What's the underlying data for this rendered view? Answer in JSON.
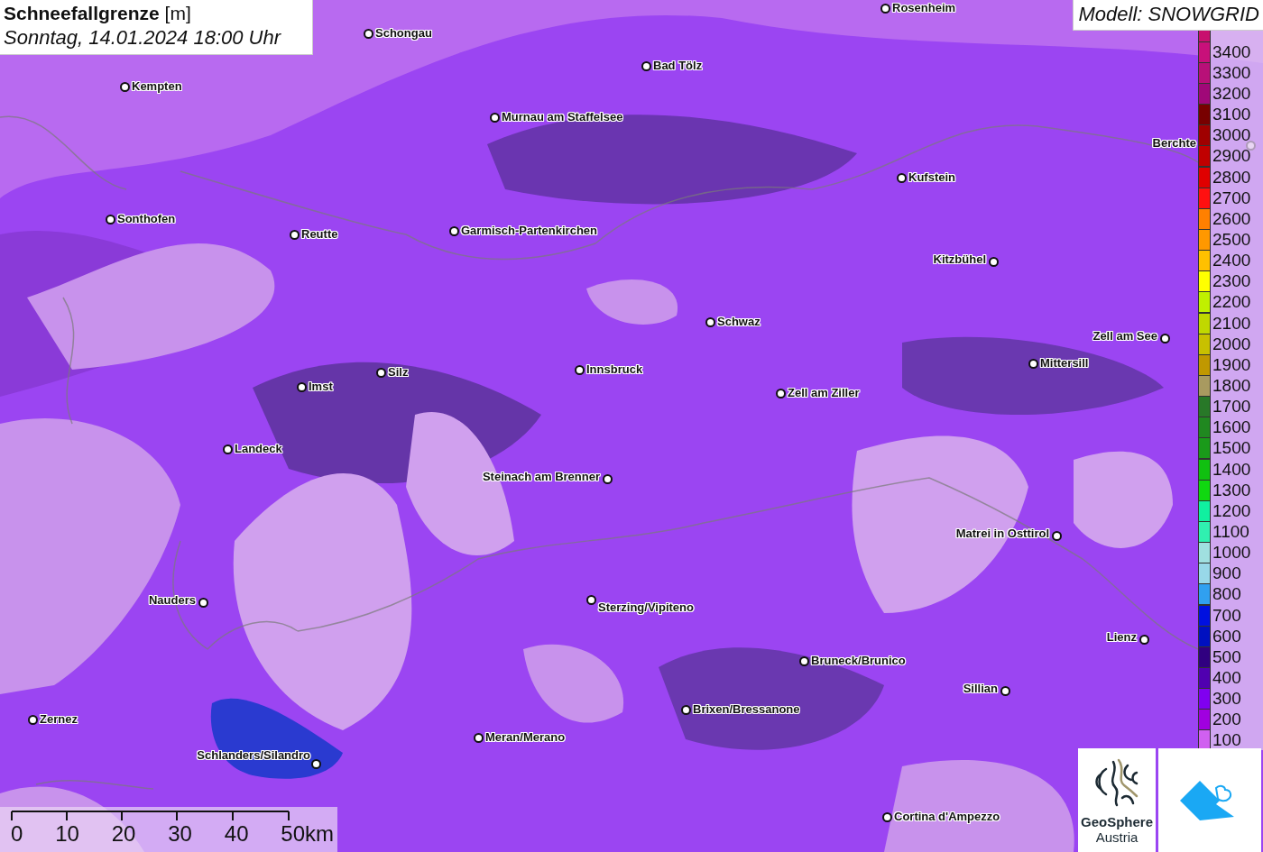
{
  "title": {
    "heading": "**Schneefallgrenze** [m]",
    "date": "Sonntag, 14.01.2024 18:00 Uhr"
  },
  "model_label": "Modell: SNOWGRID",
  "cities": [
    {
      "name": "Schongau"
    },
    {
      "name": "Rosenheim"
    },
    {
      "name": "Kempten"
    },
    {
      "name": "Bad Tölz"
    },
    {
      "name": "Murnau am Staffelsee"
    },
    {
      "name": "Berchte"
    },
    {
      "name": "Kufstein"
    },
    {
      "name": "Sonthofen"
    },
    {
      "name": "Reutte"
    },
    {
      "name": "Garmisch-Partenkirchen"
    },
    {
      "name": "Kitzbühel"
    },
    {
      "name": "Schwaz"
    },
    {
      "name": "Zell am See"
    },
    {
      "name": "Mittersill"
    },
    {
      "name": "Innsbruck"
    },
    {
      "name": "Silz"
    },
    {
      "name": "Imst"
    },
    {
      "name": "Zell am Ziller"
    },
    {
      "name": "Landeck"
    },
    {
      "name": "Steinach am Brenner"
    },
    {
      "name": "Matrei in Osttirol"
    },
    {
      "name": "Nauders"
    },
    {
      "name": "Sterzing/Vipiteno"
    },
    {
      "name": "Lienz"
    },
    {
      "name": "Bruneck/Brunico"
    },
    {
      "name": "Sillian"
    },
    {
      "name": "Brixen/Bressanone"
    },
    {
      "name": "Zernez"
    },
    {
      "name": "Meran/Merano"
    },
    {
      "name": "Schlanders/Silandro"
    },
    {
      "name": "Cortina d'Ampezzo"
    }
  ],
  "legend": [
    {
      "color": "#c8106e"
    },
    {
      "label": "3400",
      "color": "#c8107a"
    },
    {
      "label": "3300",
      "color": "#b81078"
    },
    {
      "label": "3200",
      "color": "#a00878"
    },
    {
      "label": "3100",
      "color": "#780000"
    },
    {
      "label": "3000",
      "color": "#a00000"
    },
    {
      "label": "2900",
      "color": "#c00000"
    },
    {
      "label": "2800",
      "color": "#e00000"
    },
    {
      "label": "2700",
      "color": "#ff1010"
    },
    {
      "label": "2600",
      "color": "#ff8000"
    },
    {
      "label": "2500",
      "color": "#ff9800"
    },
    {
      "label": "2400",
      "color": "#ffc000"
    },
    {
      "label": "2300",
      "color": "#ffff00"
    },
    {
      "label": "2200",
      "color": "#c0f000"
    },
    {
      "label": "2100",
      "color": "#c0d800"
    },
    {
      "label": "2000",
      "color": "#c8c000"
    },
    {
      "label": "1900",
      "color": "#c09800"
    },
    {
      "label": "1800",
      "color": "#a89a60"
    },
    {
      "label": "1700",
      "color": "#287828"
    },
    {
      "label": "1600",
      "color": "#208820"
    },
    {
      "label": "1500",
      "color": "#1a9a1a"
    },
    {
      "label": "1400",
      "color": "#10c010"
    },
    {
      "label": "1300",
      "color": "#10d810"
    },
    {
      "label": "1200",
      "color": "#10f0a0"
    },
    {
      "label": "1100",
      "color": "#30f0b0"
    },
    {
      "label": "1000",
      "color": "#a0e0e0"
    },
    {
      "label": "900",
      "color": "#98d8e8"
    },
    {
      "label": "800",
      "color": "#30a0f0"
    },
    {
      "label": "700",
      "color": "#0010e0"
    },
    {
      "label": "600",
      "color": "#0010c0"
    },
    {
      "label": "500",
      "color": "#300080"
    },
    {
      "label": "400",
      "color": "#5000b0"
    },
    {
      "label": "300",
      "color": "#8000f0"
    },
    {
      "label": "200",
      "color": "#a000e0"
    },
    {
      "label": "100",
      "color": "#d060f0"
    }
  ],
  "scale_bar": {
    "ticks": [
      "0",
      "10",
      "20",
      "30",
      "40",
      "50km"
    ]
  },
  "logos": {
    "geosphere": [
      "GeoSphere",
      "Austria"
    ]
  }
}
